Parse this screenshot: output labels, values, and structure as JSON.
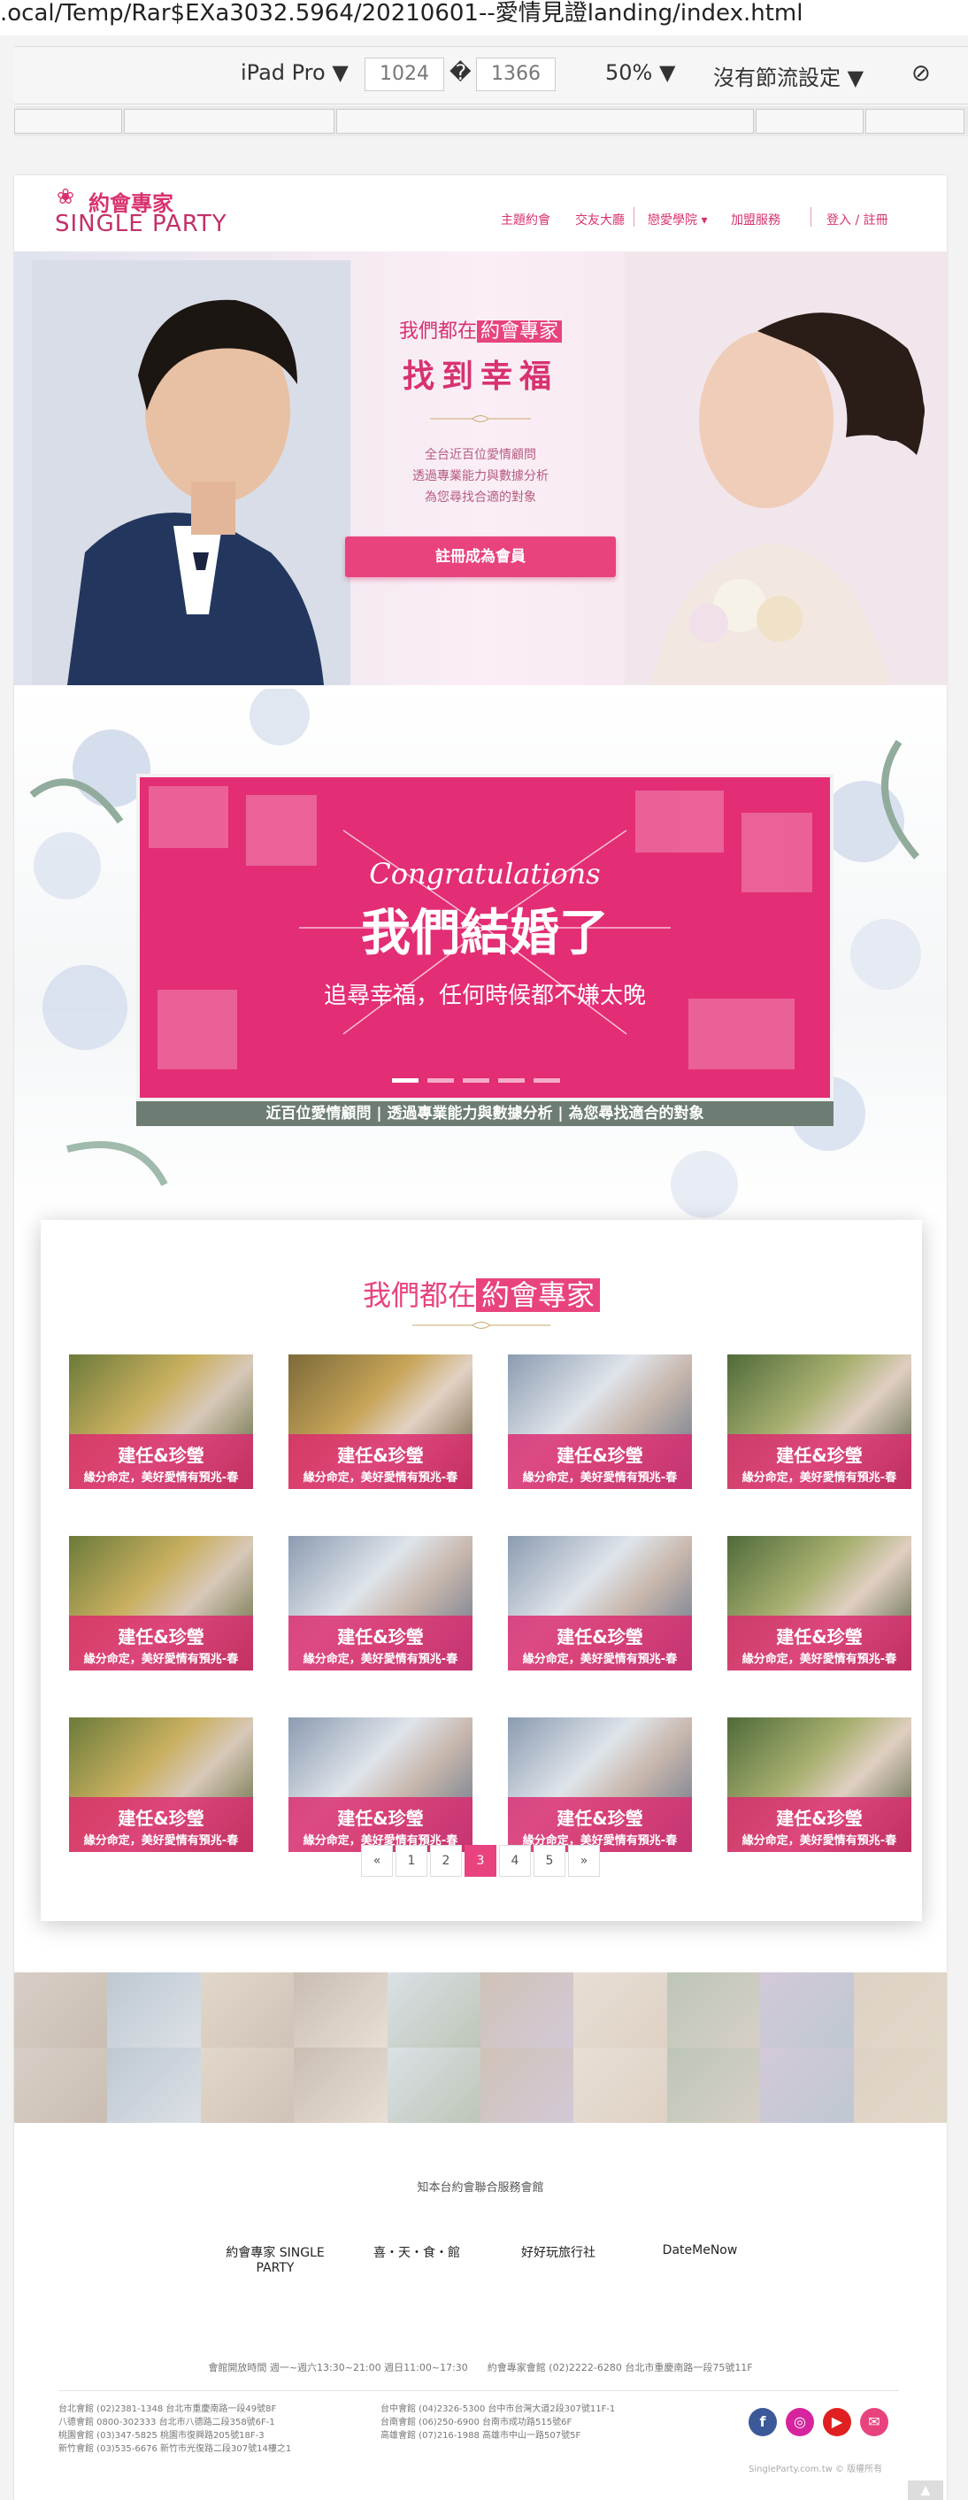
{
  "browser": {
    "url": ".ocal/Temp/Rar$EXa3032.5964/20210601--愛情見證landing/index.html",
    "device": "iPad Pro",
    "width": "1024",
    "height": "1366",
    "dim_sep": "�",
    "zoom": "50%",
    "throttle": "沒有節流設定"
  },
  "header": {
    "logo_zh": "約會專家",
    "logo_en": "SINGLE PARTY",
    "nav": [
      "主題約會",
      "交友大廳",
      "戀愛學院 ▾",
      "加盟服務"
    ],
    "login": "登入 / 註冊"
  },
  "hero": {
    "subtitle_pre": "我們都在",
    "subtitle_hl": "約會專家",
    "title": "找到幸福",
    "desc": [
      "全台近百位愛情顧問",
      "透過專業能力與數據分析",
      "為您尋找合適的對象"
    ],
    "cta": "註冊成為會員"
  },
  "banner": {
    "script": "Congratulations",
    "headline": "我們結婚了",
    "sub": "追尋幸福，任何時候都不嫌太晚",
    "caption": "近百位愛情顧問 | 透過專業能力與數據分析 | 為您尋找適合的對象"
  },
  "testimonials": {
    "title_pre": "我們都在",
    "title_hl": "約會專家",
    "items": [
      {
        "name": "建任&珍瑩",
        "tagline": "緣分命定，美好愛情有預兆-春"
      },
      {
        "name": "建任&珍瑩",
        "tagline": "緣分命定，美好愛情有預兆-春"
      },
      {
        "name": "建任&珍瑩",
        "tagline": "緣分命定，美好愛情有預兆-春"
      },
      {
        "name": "建任&珍瑩",
        "tagline": "緣分命定，美好愛情有預兆-春"
      },
      {
        "name": "建任&珍瑩",
        "tagline": "緣分命定，美好愛情有預兆-春"
      },
      {
        "name": "建任&珍瑩",
        "tagline": "緣分命定，美好愛情有預兆-春"
      },
      {
        "name": "建任&珍瑩",
        "tagline": "緣分命定，美好愛情有預兆-春"
      },
      {
        "name": "建任&珍瑩",
        "tagline": "緣分命定，美好愛情有預兆-春"
      },
      {
        "name": "建任&珍瑩",
        "tagline": "緣分命定，美好愛情有預兆-春"
      },
      {
        "name": "建任&珍瑩",
        "tagline": "緣分命定，美好愛情有預兆-春"
      },
      {
        "name": "建任&珍瑩",
        "tagline": "緣分命定，美好愛情有預兆-春"
      },
      {
        "name": "建任&珍瑩",
        "tagline": "緣分命定，美好愛情有預兆-春"
      }
    ],
    "pagination": [
      "«",
      "1",
      "2",
      "3",
      "4",
      "5",
      "»"
    ],
    "active_page": "3"
  },
  "footer": {
    "group_title": "知本台約會聯合服務會館",
    "partners": [
      "約會專家 SINGLE PARTY",
      "喜・天・食・館",
      "好好玩旅行社",
      "DateMeNow"
    ],
    "hours": "會館開放時間 週一~週六13:30~21:00 週日11:00~17:30　　約會專家會館 (02)2222-6280 台北市重慶南路一段75號11F",
    "branches_left": [
      "台北會館 (02)2381-1348 台北市重慶南路一段49號8F",
      "八德會館 0800-302333 台北市八德路二段358號6F-1",
      "桃園會館 (03)347-5825 桃園市復興路205號18F-3",
      "新竹會館 (03)535-6676 新竹市光復路二段307號14樓之1"
    ],
    "branches_right": [
      "台中會館 (04)2326-5300 台中市台灣大道2段307號11F-1",
      "台南會館 (06)250-6900 台南市成功路515號6F",
      "高雄會館 (07)216-1988 高雄市中山一路507號5F"
    ],
    "social": [
      "f",
      "◎",
      "▶",
      "✉"
    ],
    "copyright": "SingleParty.com.tw © 版權所有"
  },
  "colors": {
    "brand": "#e8437f",
    "brand_dark": "#d8326f",
    "caption": "#6d7d73"
  }
}
